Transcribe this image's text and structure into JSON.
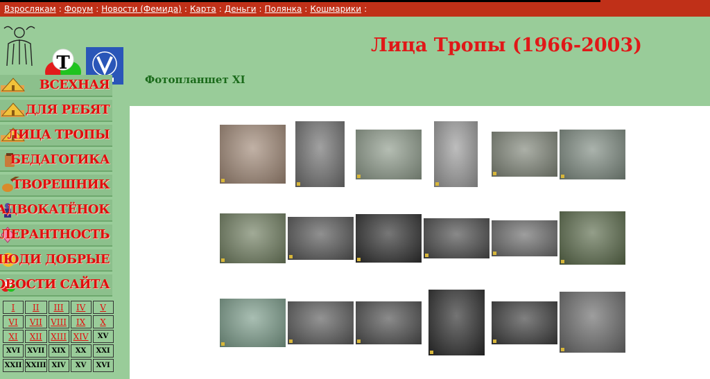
{
  "topbar": {
    "links": [
      {
        "label": "Взрослякам"
      },
      {
        "label": "Форум"
      },
      {
        "label": "Новости (Фемида)"
      },
      {
        "label": "Карта"
      },
      {
        "label": "Деньги"
      },
      {
        "label": "Полянка"
      },
      {
        "label": "Кошмарики"
      }
    ],
    "separator": ":"
  },
  "header": {
    "title": "Лица Тропы (1966-2003)",
    "subtitle": "Фотопланшет XI"
  },
  "nav": {
    "items": [
      {
        "label": "ВСЕХНАЯ",
        "icon": "tent-icon"
      },
      {
        "label": "ДЛЯ РЕБЯТ",
        "icon": "tent-icon"
      },
      {
        "label": "ЛИЦА ТРОПЫ",
        "icon": "tent-icon"
      },
      {
        "label": "БЕДАГОГИКА",
        "icon": "jar-icon"
      },
      {
        "label": "ТВОРЕШНИК",
        "icon": "guitar-icon"
      },
      {
        "label": "АДВОКАТЁНОК",
        "icon": "figure-icon"
      },
      {
        "label": "ТОЛЕРАНТНОСТЬ",
        "icon": "kite-icon"
      },
      {
        "label": "ЛЮДИ ДОБРЫЕ",
        "icon": "smiley-icon"
      },
      {
        "label": "НОВОСТИ САЙТА",
        "icon": "t-logo-icon"
      }
    ]
  },
  "sheets": {
    "rows": [
      [
        {
          "t": "I",
          "l": true
        },
        {
          "t": "II",
          "l": true
        },
        {
          "t": "III",
          "l": true
        },
        {
          "t": "IV",
          "l": true
        },
        {
          "t": "V",
          "l": true
        }
      ],
      [
        {
          "t": "VI",
          "l": true
        },
        {
          "t": "VII",
          "l": true
        },
        {
          "t": "VIII",
          "l": true
        },
        {
          "t": "IX",
          "l": true
        },
        {
          "t": "X",
          "l": true
        }
      ],
      [
        {
          "t": "XI",
          "l": true
        },
        {
          "t": "XII",
          "l": true
        },
        {
          "t": "XIII",
          "l": true
        },
        {
          "t": "XIV",
          "l": true
        },
        {
          "t": "XV",
          "l": false
        }
      ],
      [
        {
          "t": "XVI",
          "l": false
        },
        {
          "t": "XVII",
          "l": false
        },
        {
          "t": "XIX",
          "l": false
        },
        {
          "t": "XX",
          "l": false
        },
        {
          "t": "XXI",
          "l": false
        }
      ],
      [
        {
          "t": "XXII",
          "l": false
        },
        {
          "t": "XXIII",
          "l": false
        },
        {
          "t": "XIV",
          "l": false
        },
        {
          "t": "XV",
          "l": false
        },
        {
          "t": "XVI",
          "l": false
        }
      ]
    ]
  },
  "photos": [
    {
      "tone": "#a08876"
    },
    {
      "tone": "#6f6f6f"
    },
    {
      "tone": "#8d9a8a"
    },
    {
      "tone": "#9a9a9a"
    },
    {
      "tone": "#7f8578"
    },
    {
      "tone": "#7d8a80"
    },
    {
      "tone": "#6f7d5f"
    },
    {
      "tone": "#555555"
    },
    {
      "tone": "#2e2e2e"
    },
    {
      "tone": "#4a4a4a"
    },
    {
      "tone": "#6a6a6a"
    },
    {
      "tone": "#5a6a4a"
    },
    {
      "tone": "#7b9c8a"
    },
    {
      "tone": "#5a5a5a"
    },
    {
      "tone": "#4d4d4d"
    },
    {
      "tone": "#2a2a2a"
    },
    {
      "tone": "#3c3c3c"
    },
    {
      "tone": "#6a6a6a"
    }
  ]
}
